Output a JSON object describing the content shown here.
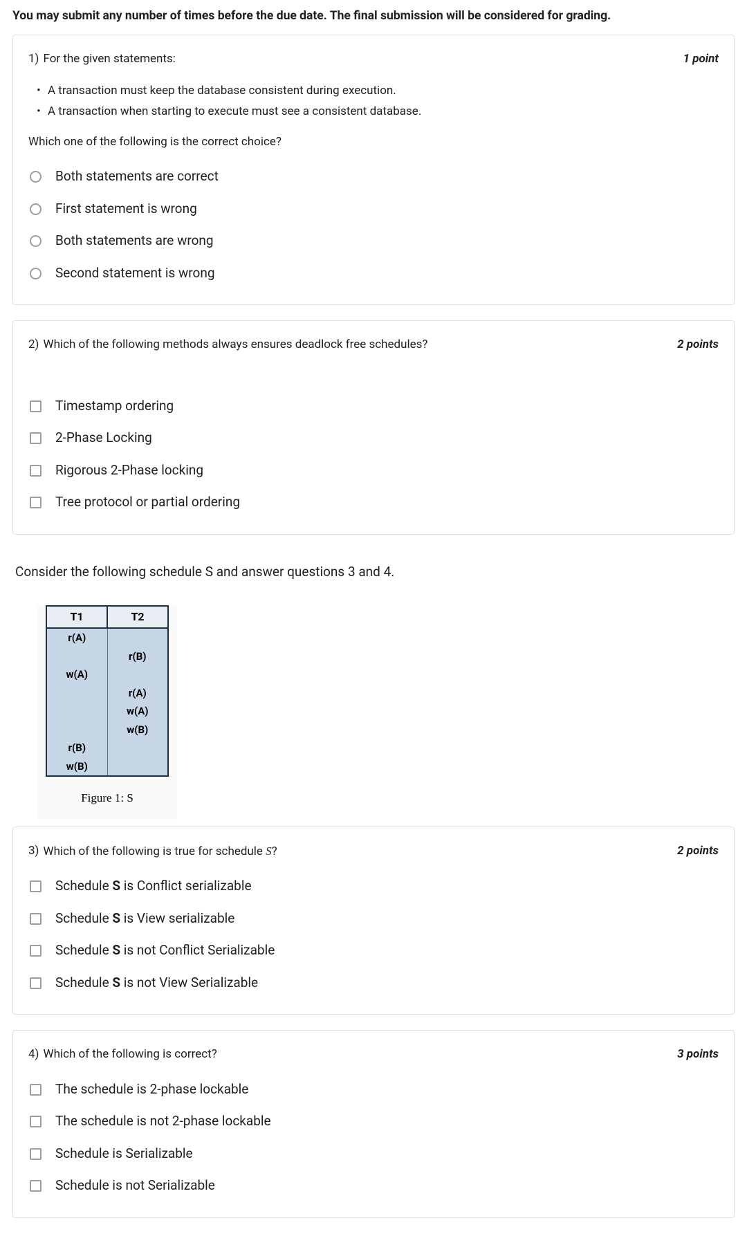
{
  "instruction": "You may submit any number of times before the due date. The final submission will be considered for grading.",
  "q1": {
    "number": "1)",
    "prompt": "For the given statements:",
    "points": "1 point",
    "bullets": [
      "A transaction must keep the database consistent during execution.",
      "A transaction when starting to execute must see a consistent database."
    ],
    "subprompt": "Which one of the following is the correct choice?",
    "options": [
      "Both statements are correct",
      "First statement is wrong",
      "Both statements are wrong",
      "Second statement is wrong"
    ]
  },
  "q2": {
    "number": "2)",
    "prompt": "Which of the following methods always ensures deadlock free schedules?",
    "points": "2 points",
    "options": [
      "Timestamp ordering",
      "2-Phase Locking",
      "Rigorous 2-Phase locking",
      "Tree protocol or partial ordering"
    ]
  },
  "intertext": "Consider the following schedule S and answer questions 3 and 4.",
  "figure": {
    "headers": [
      "T1",
      "T2"
    ],
    "rows": [
      [
        "r(A)",
        ""
      ],
      [
        "",
        "r(B)"
      ],
      [
        "w(A)",
        ""
      ],
      [
        "",
        "r(A)"
      ],
      [
        "",
        "w(A)"
      ],
      [
        "",
        "w(B)"
      ],
      [
        "r(B)",
        ""
      ],
      [
        "w(B)",
        ""
      ]
    ],
    "caption": "Figure 1: S"
  },
  "q3": {
    "number": "3)",
    "prompt_pre": "Which of the following is true for schedule ",
    "prompt_italic": "S",
    "prompt_post": "?",
    "points": "2 points",
    "options": [
      {
        "pre": "Schedule ",
        "bold": "S",
        "post": " is Conflict serializable"
      },
      {
        "pre": "Schedule ",
        "bold": "S",
        "post": " is View serializable"
      },
      {
        "pre": "Schedule ",
        "bold": "S",
        "post": " is not Conflict Serializable"
      },
      {
        "pre": "Schedule ",
        "bold": "S",
        "post": " is not View Serializable"
      }
    ]
  },
  "q4": {
    "number": "4)",
    "prompt": "Which of the following is correct?",
    "points": "3 points",
    "options": [
      "The schedule is 2-phase lockable",
      "The schedule is not 2-phase lockable",
      "Schedule is Serializable",
      "Schedule is not Serializable"
    ]
  }
}
